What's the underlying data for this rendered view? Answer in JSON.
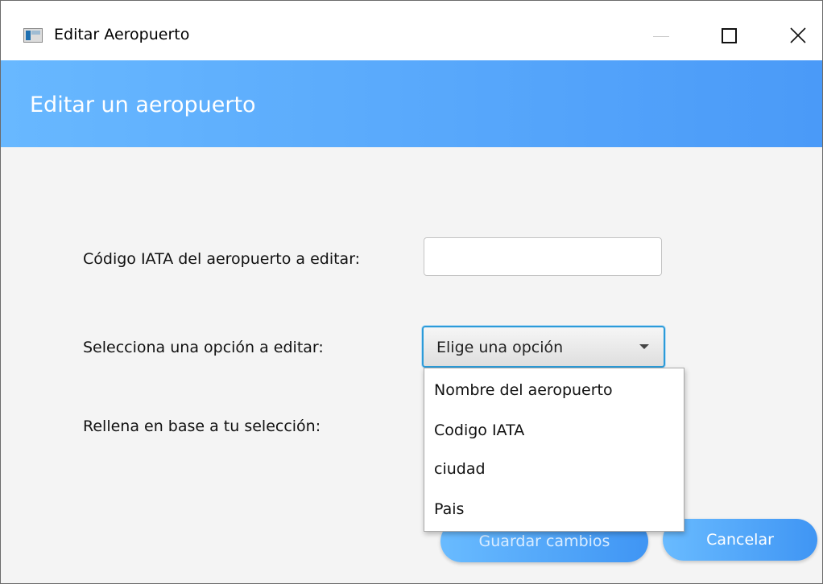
{
  "window": {
    "title": "Editar Aeropuerto",
    "icon": "app-window-icon",
    "controls": [
      "minimize-icon",
      "maximize-icon",
      "close-icon"
    ]
  },
  "header": {
    "title": "Editar un aeropuerto",
    "colors": {
      "gradient_start": "#68b8ff",
      "gradient_end": "#4a9af8"
    }
  },
  "form": {
    "iata_label": "Código IATA del aeropuerto a editar:",
    "iata_value": "",
    "option_label": "Selecciona una opción a editar:",
    "option_selected": "Elige una opción",
    "fill_label": "Rellena en base a tu selección:"
  },
  "dropdown": {
    "options": [
      "Nombre del aeropuerto",
      "Codigo IATA",
      "ciudad",
      "Pais"
    ]
  },
  "buttons": {
    "save_label": "Guardar cambios",
    "cancel_label": "Cancelar"
  }
}
